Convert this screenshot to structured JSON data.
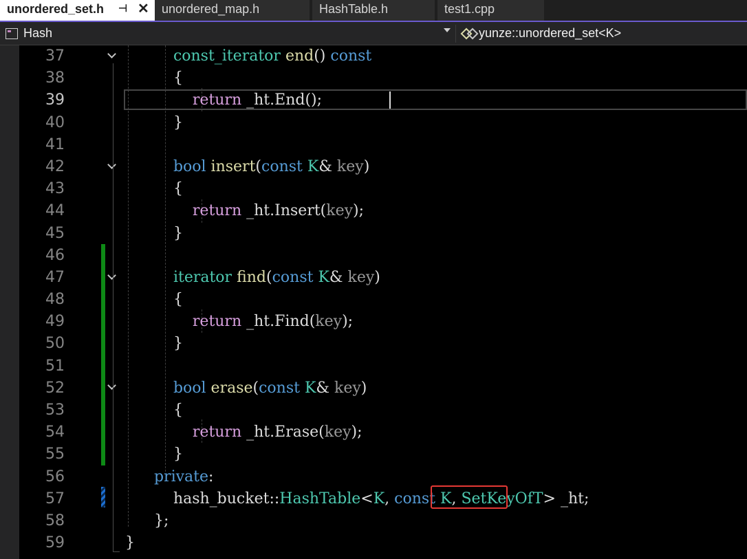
{
  "tabs": [
    {
      "label": "unordered_set.h",
      "active": true
    },
    {
      "label": "unordered_map.h",
      "active": false
    },
    {
      "label": "HashTable.h",
      "active": false
    },
    {
      "label": "test1.cpp",
      "active": false
    }
  ],
  "tab_icons": {
    "pin": "pin-icon",
    "close": "close-icon"
  },
  "nav": {
    "project": "Hash",
    "scope": "yunze::unordered_set<K>",
    "project_icon": "project-icon",
    "scope_icon": "class-icon"
  },
  "editor": {
    "current_line": 39,
    "line_numbers": [
      "37",
      "38",
      "39",
      "40",
      "41",
      "42",
      "43",
      "44",
      "45",
      "46",
      "47",
      "48",
      "49",
      "50",
      "51",
      "52",
      "53",
      "54",
      "55",
      "56",
      "57",
      "58",
      "59"
    ]
  },
  "code": {
    "l37": {
      "t1": "const_iterator",
      "t2": "end",
      "t3": "()",
      "t4": "const"
    },
    "l38": "{",
    "l39": {
      "kw": "return",
      "rest": "_ht.End();"
    },
    "l40": "}",
    "l42": {
      "t1": "bool",
      "t2": "insert",
      "t3": "(",
      "t4": "const",
      "t5": "K",
      "t6": "&",
      "t7": "key",
      "t8": ")"
    },
    "l43": "{",
    "l44": {
      "kw": "return",
      "rest": "_ht.Insert(",
      "arg": "key",
      "end": ");"
    },
    "l45": "}",
    "l47": {
      "t1": "iterator",
      "t2": "find",
      "t3": "(",
      "t4": "const",
      "t5": "K",
      "t6": "&",
      "t7": "key",
      "t8": ")"
    },
    "l48": "{",
    "l49": {
      "kw": "return",
      "rest": "_ht.Find(",
      "arg": "key",
      "end": ");"
    },
    "l50": "}",
    "l52": {
      "t1": "bool",
      "t2": "erase",
      "t3": "(",
      "t4": "const",
      "t5": "K",
      "t6": "&",
      "t7": "key",
      "t8": ")"
    },
    "l53": "{",
    "l54": {
      "kw": "return",
      "rest": "_ht.Erase(",
      "arg": "key",
      "end": ");"
    },
    "l55": "}",
    "l56": {
      "kw": "private",
      "p": ":"
    },
    "l57": {
      "ns": "hash_bucket::",
      "cls": "HashTable",
      "lt": "<",
      "k1": "K",
      "c1": ", ",
      "ck": "const",
      "k2": "K",
      "c2": ",",
      "soft": "SetKeyOfT",
      "rest": "> _ht;"
    },
    "l58": "};",
    "l59": "}"
  },
  "colors": {
    "keyword": "#569cd6",
    "return_keyword": "#d8a0df",
    "function": "#dcdcaa",
    "type": "#4ec9b0",
    "parameter": "#9a9a9a",
    "highlight_box": "#e53935",
    "change_bar": "#0e8a16",
    "tab_accent": "#6a5acd"
  }
}
